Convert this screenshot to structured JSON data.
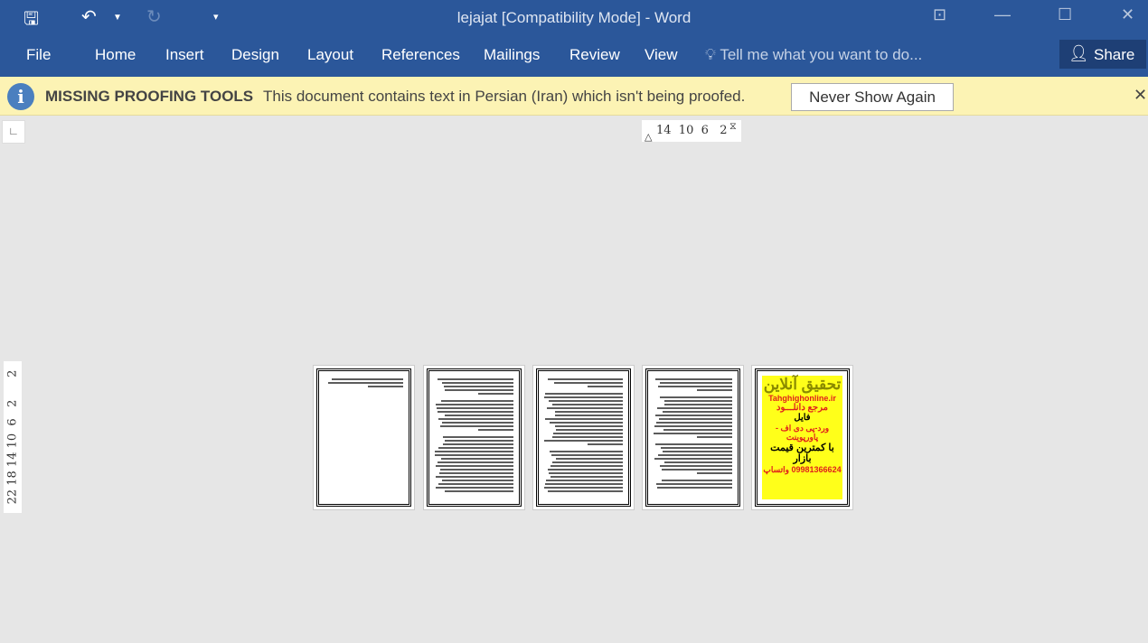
{
  "titlebar": {
    "title": "lejajat [Compatibility Mode] - Word"
  },
  "menu": {
    "items": [
      "File",
      "Home",
      "Insert",
      "Design",
      "Layout",
      "References",
      "Mailings",
      "Review",
      "View"
    ],
    "tell_me": "Tell me what you want to do...",
    "share": "Share"
  },
  "message_bar": {
    "title": "MISSING PROOFING TOOLS",
    "text": "This document contains text in Persian (Iran) which isn't being proofed.",
    "button": "Never Show Again"
  },
  "ruler": {
    "horizontal": "14  10  6   2",
    "vertical": "22 18 14 10  6   2      2"
  },
  "pages": {
    "count": 5,
    "ad": {
      "line1": "تحقیق آنلاین",
      "site": "Tahghighonline.ir",
      "line2": "مرجع دانلـــود",
      "line3": "فایل",
      "line4": "ورد-پی دی اف - پاورپوینت",
      "line5": "با کمترین قیمت بازار",
      "line6": "09981366624 واتساپ"
    }
  },
  "colors": {
    "ribbon": "#2b579a",
    "message_bar": "#fcf3b4",
    "canvas": "#e6e6e6"
  }
}
